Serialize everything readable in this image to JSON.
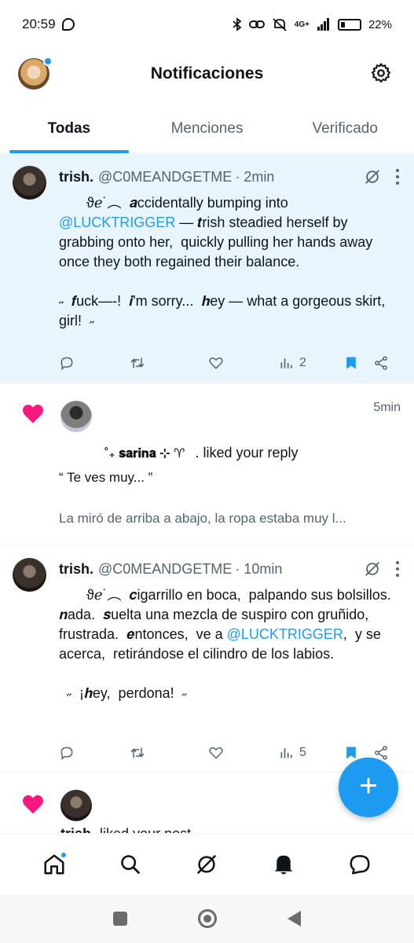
{
  "status_bar": {
    "time": "20:59",
    "network": "4G+",
    "battery": "22%",
    "battery_level": 0.22
  },
  "header": {
    "title": "Notificaciones"
  },
  "tabs": [
    {
      "label": "Todas",
      "active": true
    },
    {
      "label": "Menciones",
      "active": false
    },
    {
      "label": "Verificado",
      "active": false
    }
  ],
  "posts": [
    {
      "name": "trish.",
      "handle": "@C0MEANDGETME",
      "time": "· 2min",
      "body_pre": "       ϑℯ˙︵  𝒂ccidentally bumping into",
      "mention": "@LUCKTRIGGER",
      "body_post": " — 𝒕rish steadied herself by grabbing onto her,  quickly pulling her hands away once they both regained their balance.\n\n˶  𝒇uck—-!  𝒊'm sorry...  𝒉ey — what a gorgeous skirt,  girl!  ˶",
      "views": "2",
      "bookmarked": true
    },
    {
      "name": "trish.",
      "handle": "@C0MEANDGETME",
      "time": "· 10min",
      "body_pre": "       ϑℯ˙︵  𝒄igarrillo en boca,  palpando sus bolsillos.  𝒏ada.  𝒔uelta una mezcla de suspiro con gruñido,  frustrada.  𝒆ntonces,  ve a ",
      "mention": "@LUCKTRIGGER",
      "body_post": ",  y se acerca,  retirándose el cilindro de los labios.\n\n  ˶  ¡𝒉ey,  perdona!  ˶",
      "views": "5",
      "bookmarked": true
    }
  ],
  "like_notification": {
    "time": "5min",
    "actor": "˚₊ 𝐬𝐚𝐫𝐢𝐧𝐚 ⊹ ♈",
    "action": ". liked your reply",
    "quote": "“ Te ves muy... ”",
    "preview": "La miró de arriba a abajo, la ropa estaba muy l..."
  },
  "like_notification_2": {
    "actor": "trish",
    "action": "liked your post"
  },
  "fab": {
    "label": "+"
  },
  "bottom_nav": [
    "home-icon",
    "search-icon",
    "grok-icon",
    "notifications-icon",
    "messages-icon"
  ]
}
